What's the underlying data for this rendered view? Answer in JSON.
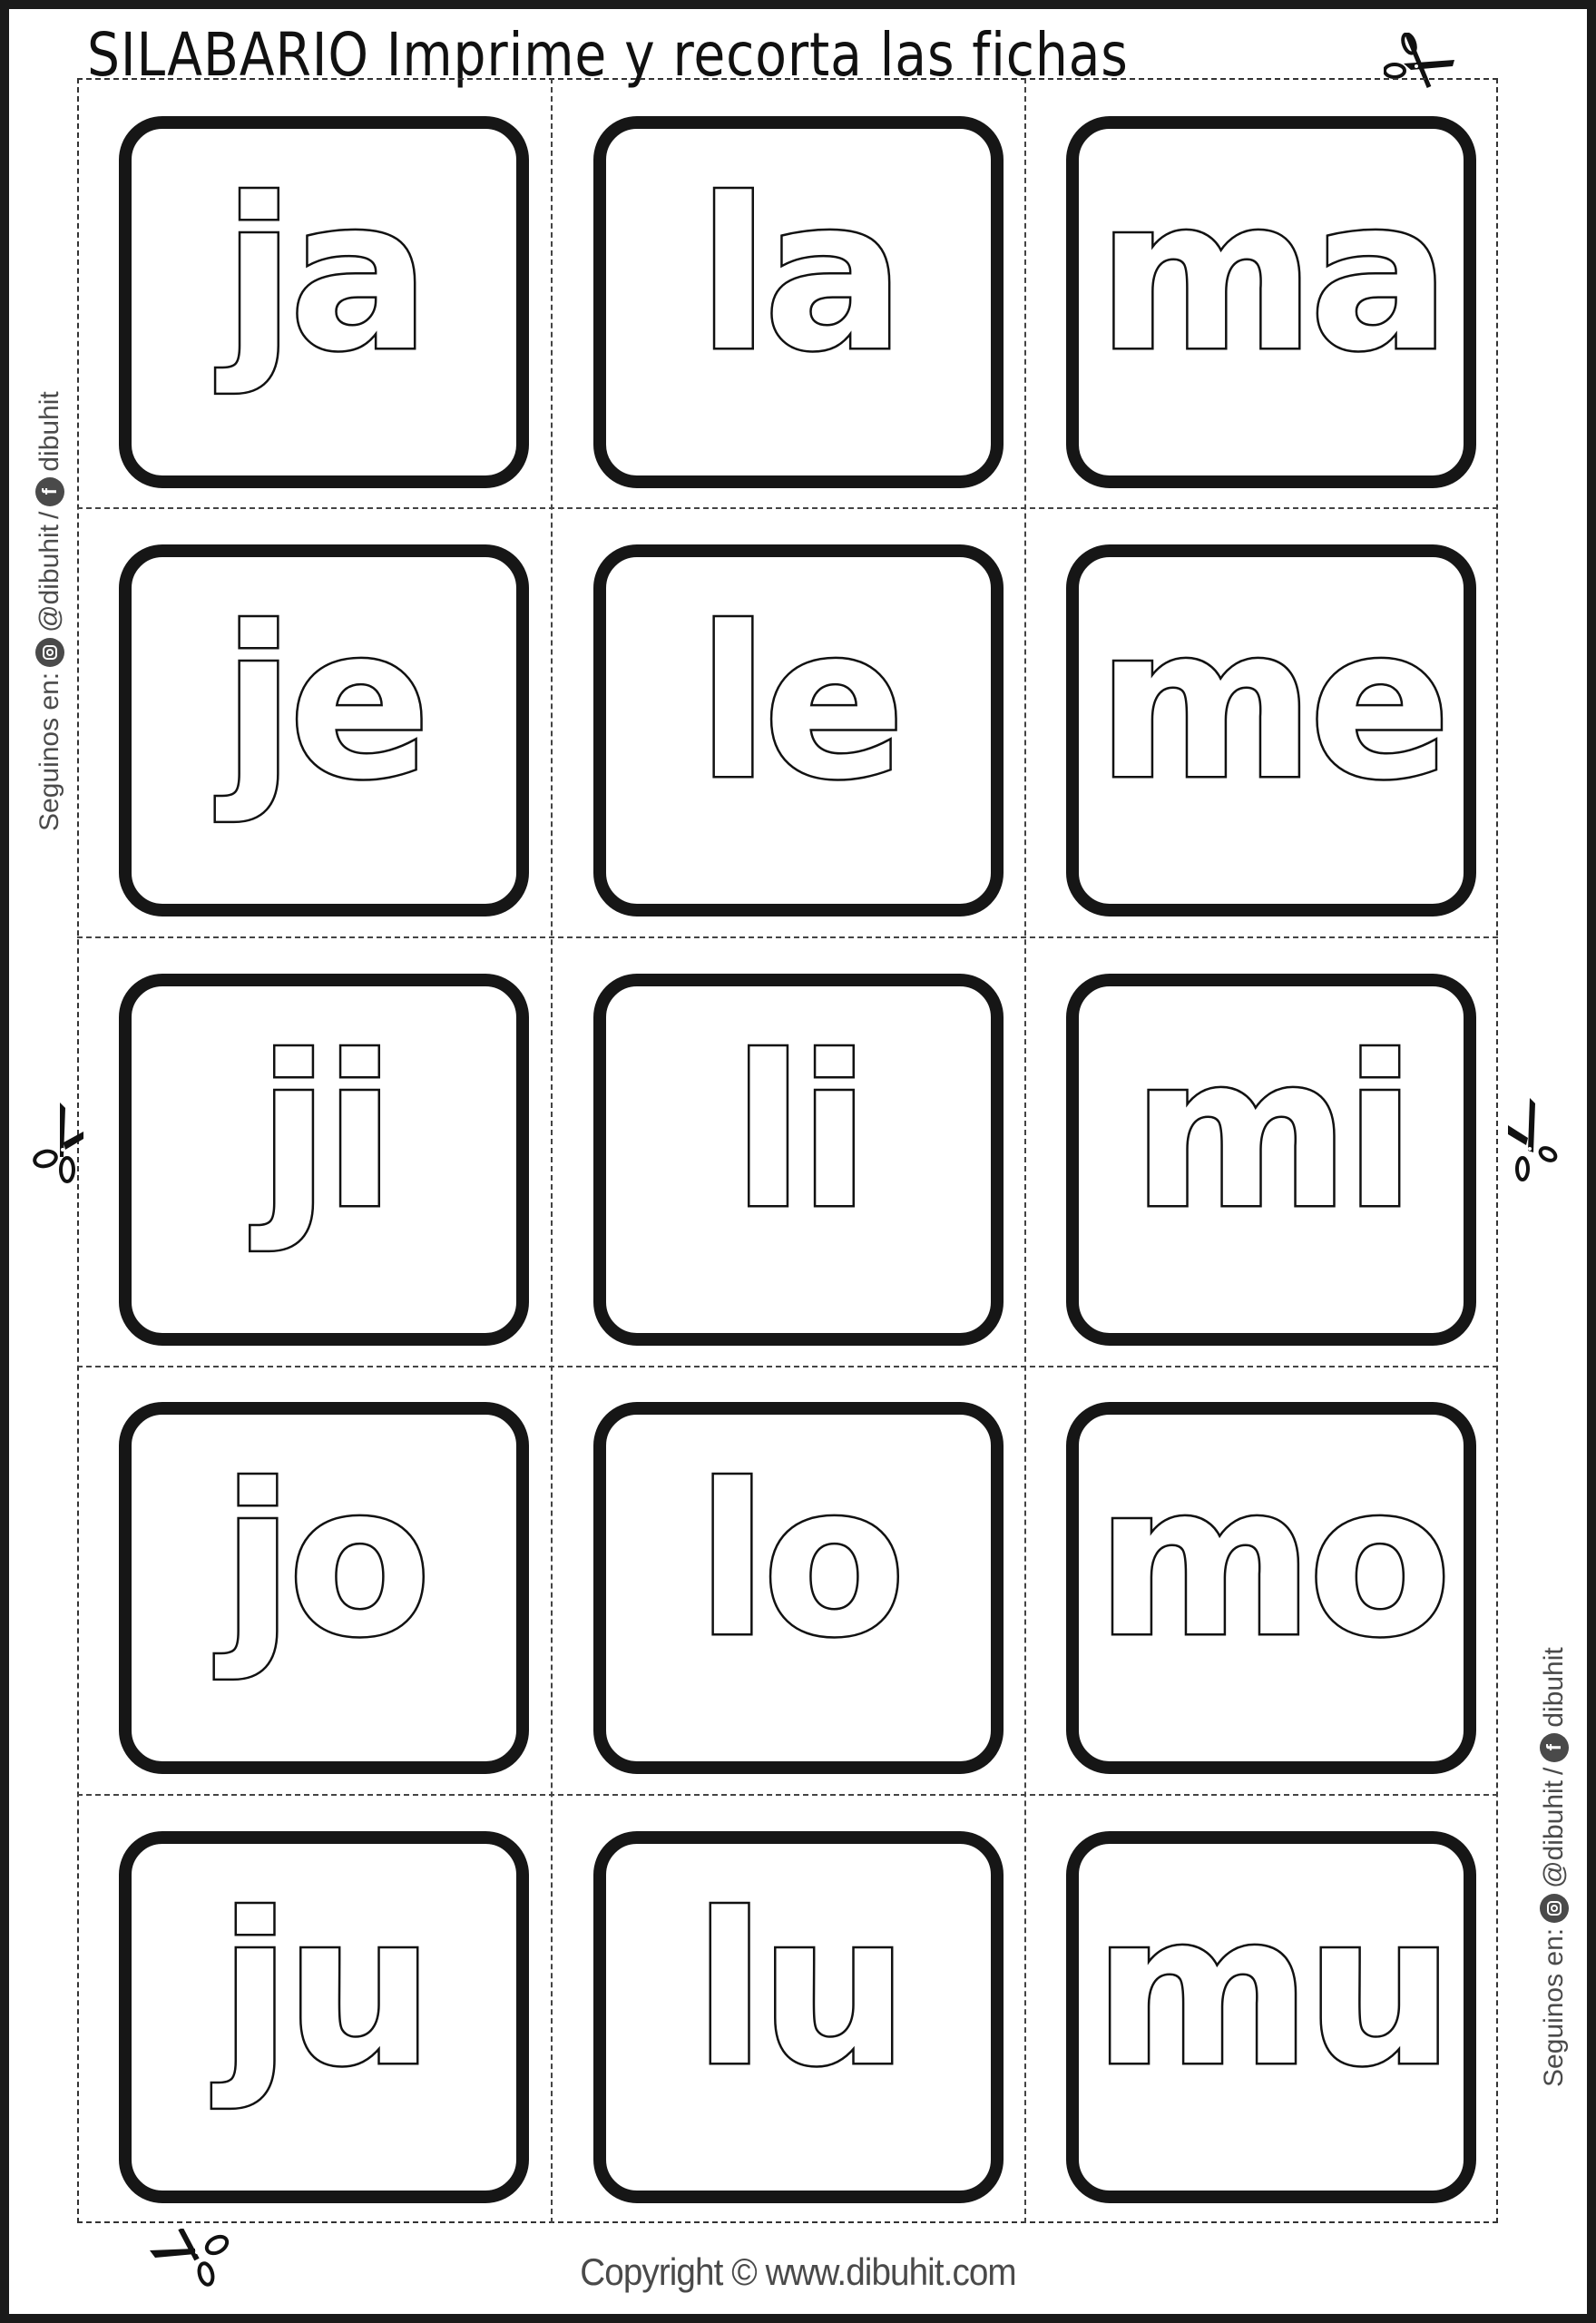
{
  "header": {
    "title": "SILABARIO  Imprime y recorta las fichas",
    "scissors_icon": "scissors-icon"
  },
  "side_credit": {
    "prefix": "Seguinos en:",
    "instagram_icon": "instagram-icon",
    "instagram_handle": "@dibuhit",
    "separator": "/",
    "facebook_icon": "facebook-icon",
    "facebook_handle": "dibuhit"
  },
  "cards": [
    [
      "ja",
      "la",
      "ma"
    ],
    [
      "je",
      "le",
      "me"
    ],
    [
      "ji",
      "li",
      "mi"
    ],
    [
      "jo",
      "lo",
      "mo"
    ],
    [
      "ju",
      "lu",
      "mu"
    ]
  ],
  "footer": {
    "copyright": "Copyright © www.dibuhit.com"
  },
  "colors": {
    "ink": "#111111",
    "credit_gray": "#4a4a4a",
    "frame": "#1a1a1a",
    "paper": "#ffffff"
  }
}
